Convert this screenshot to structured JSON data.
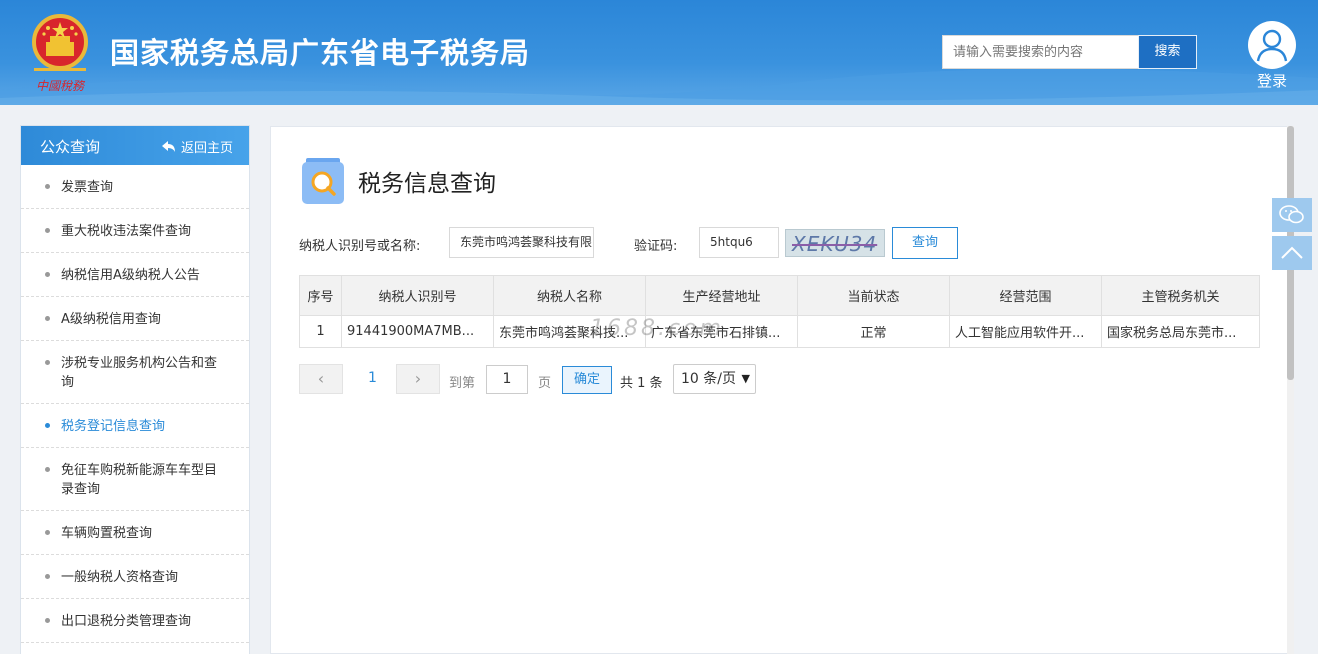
{
  "header": {
    "emblem_text": "中國稅務",
    "title": "国家税务总局广东省电子税务局",
    "search_placeholder": "请输入需要搜索的内容",
    "search_button": "搜索",
    "login_label": "登录",
    "icons": [
      "national-emblem-icon",
      "user-icon"
    ]
  },
  "sidebar": {
    "title": "公众查询",
    "back_label": "返回主页",
    "items": [
      {
        "label": "发票查询"
      },
      {
        "label": "重大税收违法案件查询"
      },
      {
        "label": "纳税信用A级纳税人公告"
      },
      {
        "label": "A级纳税信用查询"
      },
      {
        "label": "涉税专业服务机构公告和查询"
      },
      {
        "label": "税务登记信息查询",
        "active": true
      },
      {
        "label": "免征车购税新能源车车型目录查询"
      },
      {
        "label": "车辆购置税查询"
      },
      {
        "label": "一般纳税人资格查询"
      },
      {
        "label": "出口退税分类管理查询"
      }
    ]
  },
  "main": {
    "title": "税务信息查询",
    "form": {
      "taxpayer_label": "纳税人识别号或名称:",
      "taxpayer_value": "东莞市鸣鸿荟聚科技有限",
      "captcha_label": "验证码:",
      "captcha_value": "5htqu6",
      "captcha_image_text": "XEKU34",
      "query_button": "查询"
    },
    "table": {
      "headers": [
        "序号",
        "纳税人识别号",
        "纳税人名称",
        "生产经营地址",
        "当前状态",
        "经营范围",
        "主管税务机关"
      ],
      "rows": [
        [
          "1",
          "91441900MA7MB...",
          "东莞市鸣鸿荟聚科技...",
          "广东省东莞市石排镇...",
          "正常",
          "人工智能应用软件开...",
          "国家税务总局东莞市..."
        ]
      ]
    },
    "watermark": "1688.com",
    "pagination": {
      "prev": "‹",
      "current_page": "1",
      "next": "›",
      "goto_label": "到第",
      "goto_value": "1",
      "page_unit": "页",
      "confirm": "确定",
      "total": "共 1 条",
      "page_size": "10 条/页"
    }
  },
  "float_buttons": [
    "wechat-icon",
    "back-to-top-icon"
  ],
  "colors": {
    "header_blue": "#2b86d8",
    "accent": "#2a8bd8",
    "active_item": "#2a8bd8"
  }
}
